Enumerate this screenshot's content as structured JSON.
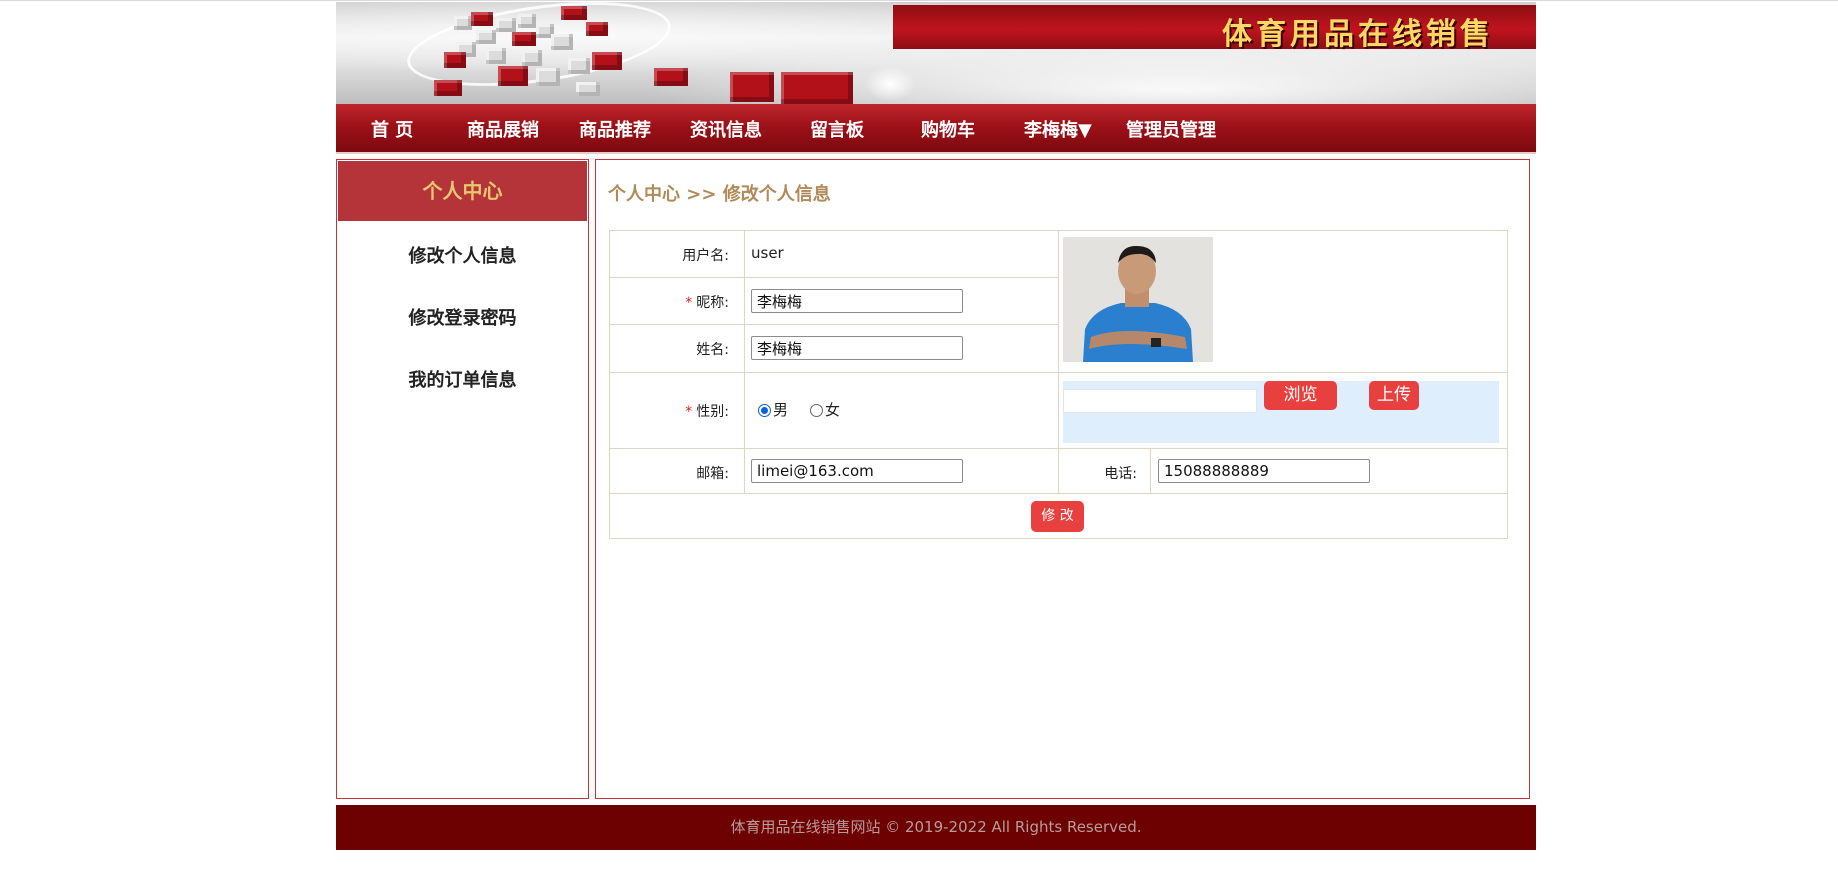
{
  "site": {
    "title": "体育用品在线销售"
  },
  "nav": {
    "items": [
      "首 页",
      "商品展销",
      "商品推荐",
      "资讯信息",
      "留言板",
      "购物车",
      "李梅梅▼",
      "管理员管理"
    ]
  },
  "sidebar": {
    "heading": "个人中心",
    "items": [
      "修改个人信息",
      "修改登录密码",
      "我的订单信息"
    ]
  },
  "main": {
    "breadcrumb": "个人中心 >> 修改个人信息"
  },
  "form": {
    "username_label": "用户名:",
    "username_value": "user",
    "nickname_label": "昵称:",
    "nickname_value": "李梅梅",
    "name_label": "姓名:",
    "name_value": "李梅梅",
    "gender_label": "性别:",
    "gender_options": [
      "男",
      "女"
    ],
    "gender_selected": "男",
    "email_label": "邮箱:",
    "email_value": "limei@163.com",
    "phone_label": "电话:",
    "phone_value": "15088888889",
    "required_mark": "*",
    "browse_label": "浏览",
    "upload_label": "上传",
    "submit_label": "修 改"
  },
  "footer": {
    "text": "体育用品在线销售网站  © 2019-2022 All Rights Reserved."
  },
  "colors": {
    "brand_red": "#9d1118",
    "footer_red": "#6d0000",
    "button_red": "#e8403e",
    "accent_gold": "#b08a58"
  }
}
